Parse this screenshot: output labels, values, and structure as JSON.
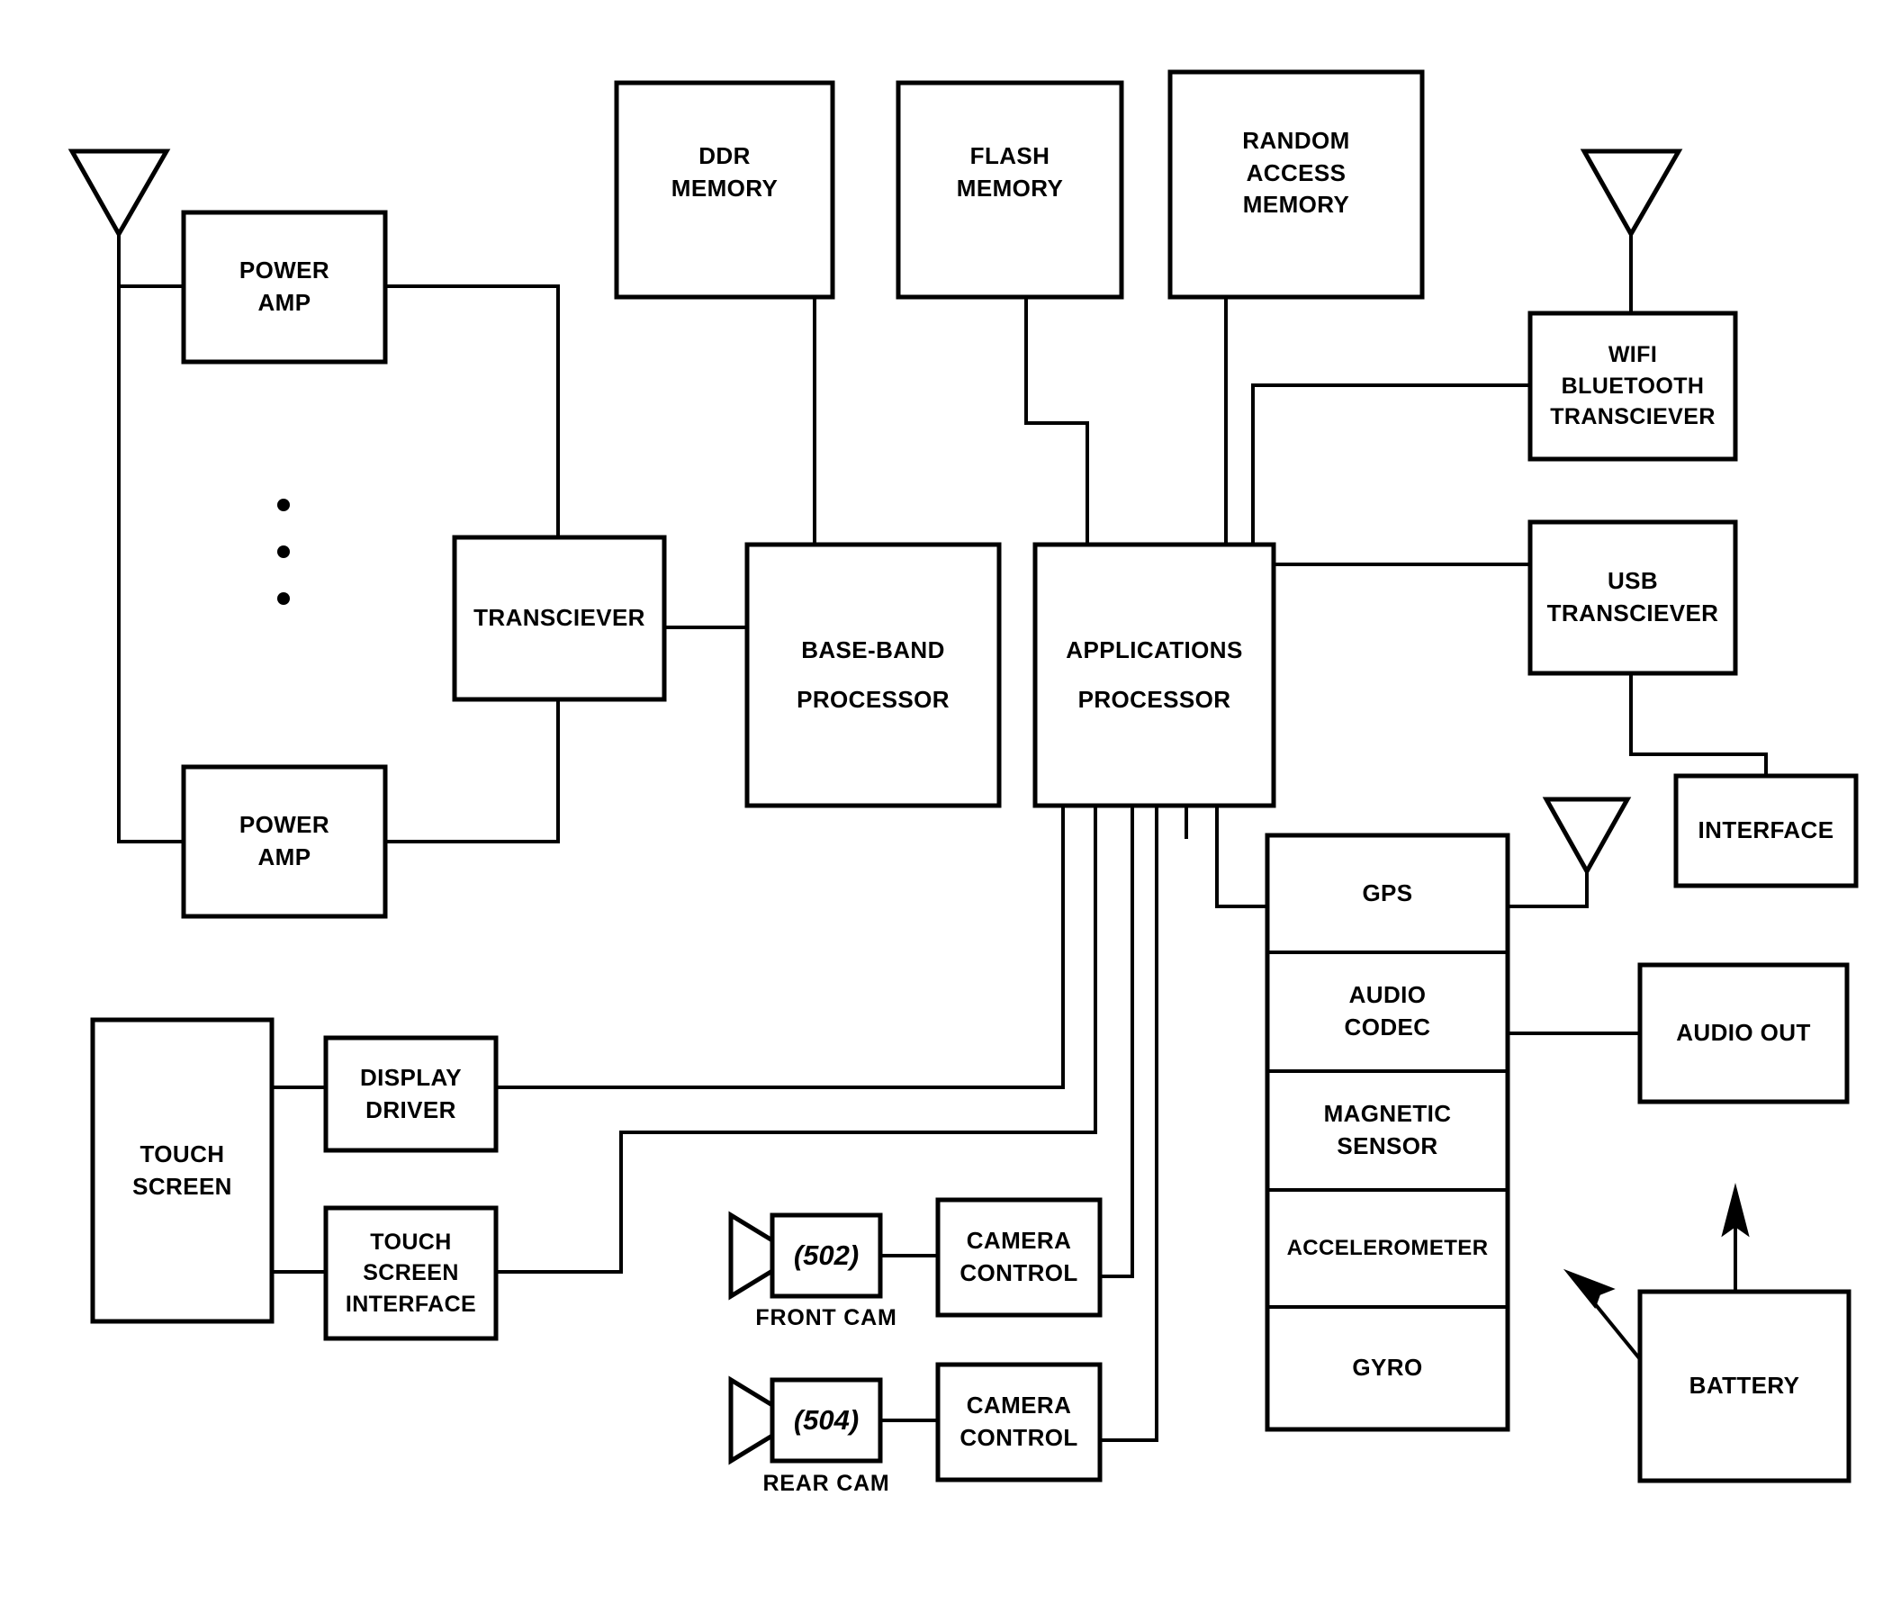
{
  "diagram": {
    "title": "Mobile device hardware block diagram",
    "type": "block-diagram",
    "line_color": "#000000",
    "background_color": "#ffffff"
  },
  "blocks": {
    "power_amp_top": "POWER\nAMP",
    "power_amp_bottom": "POWER\nAMP",
    "transceiver": "TRANSCIEVER",
    "ddr_memory": "DDR\nMEMORY",
    "flash_memory": "FLASH\nMEMORY",
    "random_access_memory": "RANDOM\nACCESS\nMEMORY",
    "baseband_processor": "BASE-BAND\nPROCESSOR",
    "applications_processor": "APPLICATIONS\nPROCESSOR",
    "wifi_bluetooth_transceiver": "WIFI\nBLUETOOTH\nTRANSCIEVER",
    "usb_transceiver": "USB\nTRANSCIEVER",
    "interface": "INTERFACE",
    "gps": "GPS",
    "audio_codec": "AUDIO\nCODEC",
    "magnetic_sensor": "MAGNETIC\nSENSOR",
    "accelerometer": "ACCELEROMETER",
    "gyro": "GYRO",
    "audio_out": "AUDIO OUT",
    "battery": "BATTERY",
    "touch_screen": "TOUCH\nSCREEN",
    "display_driver": "DISPLAY\nDRIVER",
    "touch_screen_interface": "TOUCH\nSCREEN\nINTERFACE",
    "front_cam_number": "(502)",
    "front_cam_caption": "FRONT CAM",
    "front_camera_control": "CAMERA\nCONTROL",
    "rear_cam_number": "(504)",
    "rear_cam_caption": "REAR CAM",
    "rear_camera_control": "CAMERA\nCONTROL"
  },
  "icons": {
    "antenna_cellular_top": "antenna-icon",
    "antenna_wifi": "antenna-icon",
    "antenna_gps": "antenna-icon",
    "front_cam_lens": "camera-lens-icon",
    "rear_cam_lens": "camera-lens-icon",
    "battery_arrow_up": "arrow-up-icon",
    "battery_arrow_diagonal": "arrow-upleft-icon",
    "vertical_ellipsis": "vertical-ellipsis-icon"
  }
}
